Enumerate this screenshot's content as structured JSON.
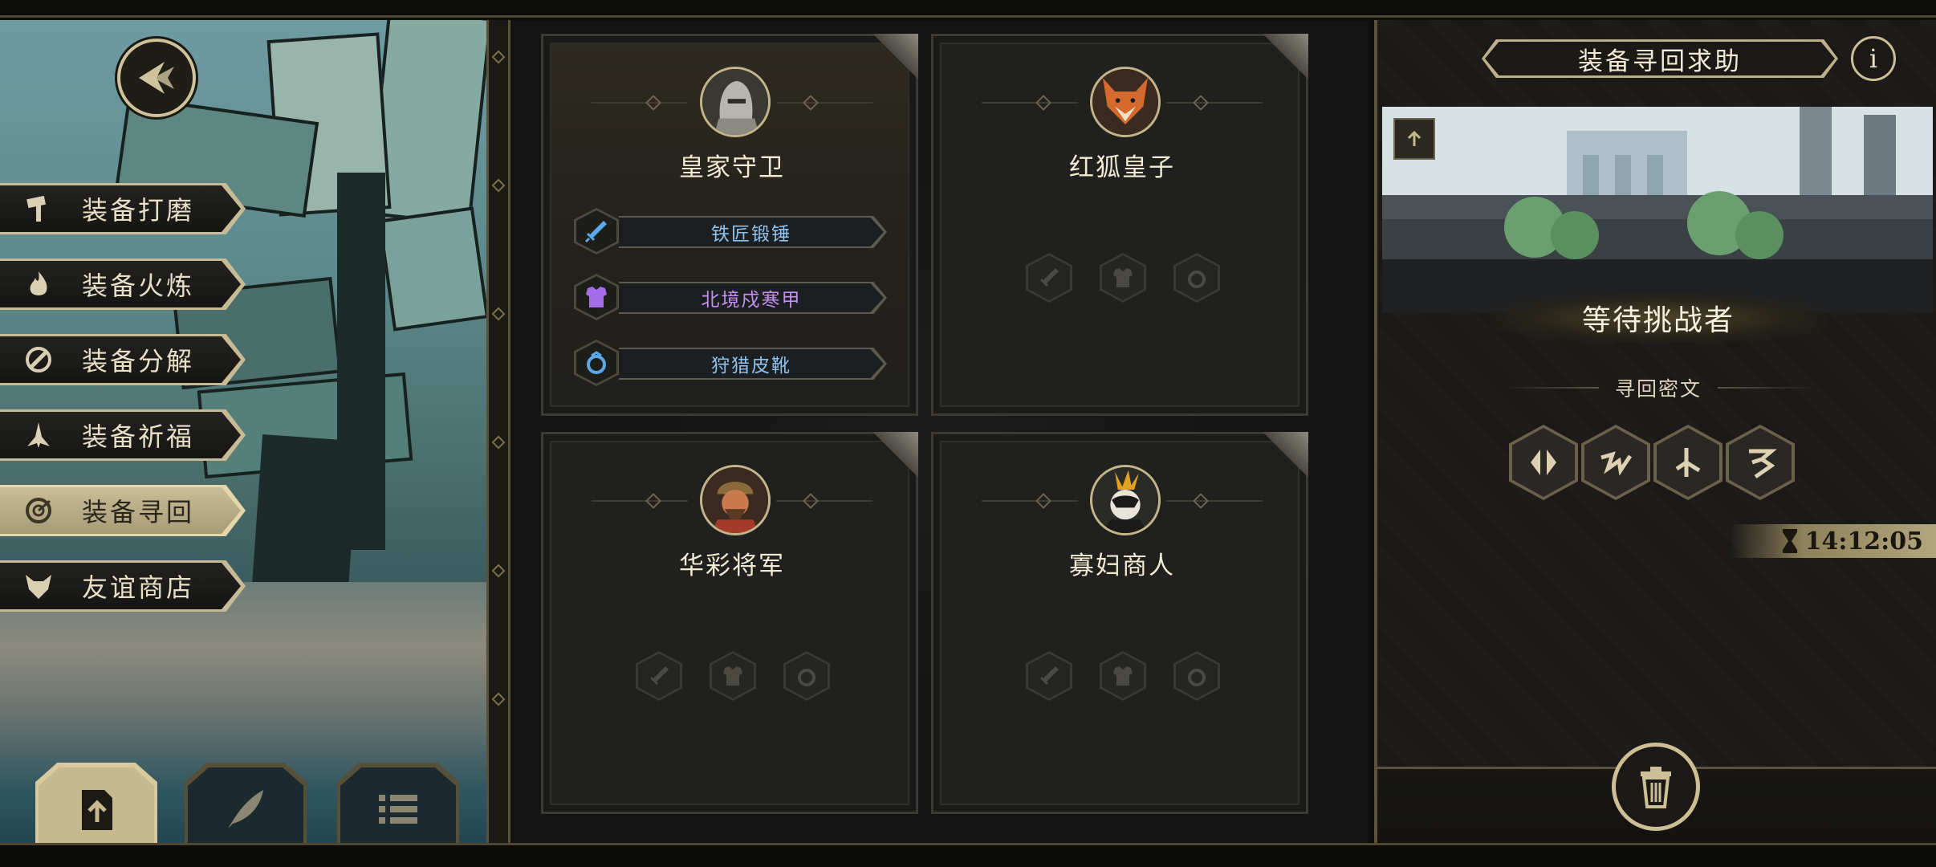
{
  "side_menu": {
    "items": [
      {
        "label": "装备打磨",
        "icon": "hammer-icon"
      },
      {
        "label": "装备火炼",
        "icon": "flame-icon"
      },
      {
        "label": "装备分解",
        "icon": "disassemble-icon"
      },
      {
        "label": "装备祈福",
        "icon": "pray-icon"
      },
      {
        "label": "装备寻回",
        "icon": "target-icon",
        "active": true
      },
      {
        "label": "友谊商店",
        "icon": "fox-icon"
      }
    ]
  },
  "bottom_buttons": [
    "upload-icon",
    "feather-icon",
    "list-icon"
  ],
  "characters": [
    {
      "name": "皇家守卫",
      "portrait": "knight-portrait-icon",
      "equipment": [
        {
          "name": "铁匠锻锤",
          "icon": "sword-icon",
          "color": "#8fc2ee"
        },
        {
          "name": "北境戍寒甲",
          "icon": "armor-icon",
          "color": "#c690f0"
        },
        {
          "name": "狩猎皮靴",
          "icon": "ring-icon",
          "color": "#8fc2ee"
        }
      ]
    },
    {
      "name": "红狐皇子",
      "portrait": "fox-prince-portrait-icon",
      "equipment": []
    },
    {
      "name": "华彩将军",
      "portrait": "general-portrait-icon",
      "equipment": []
    },
    {
      "name": "寡妇商人",
      "portrait": "widow-merchant-portrait-icon",
      "equipment": []
    }
  ],
  "right_panel": {
    "title": "装备寻回求助",
    "info": "i",
    "status": "等待挑战者",
    "cipher_title": "寻回密文",
    "runes": [
      "rune-1-icon",
      "rune-2-icon",
      "rune-3-icon",
      "rune-4-icon"
    ],
    "timer": "14:12:05"
  },
  "colors": {
    "gold": "#cfc39b",
    "accent_blue": "#8fc2ee",
    "accent_purple": "#c690f0"
  }
}
